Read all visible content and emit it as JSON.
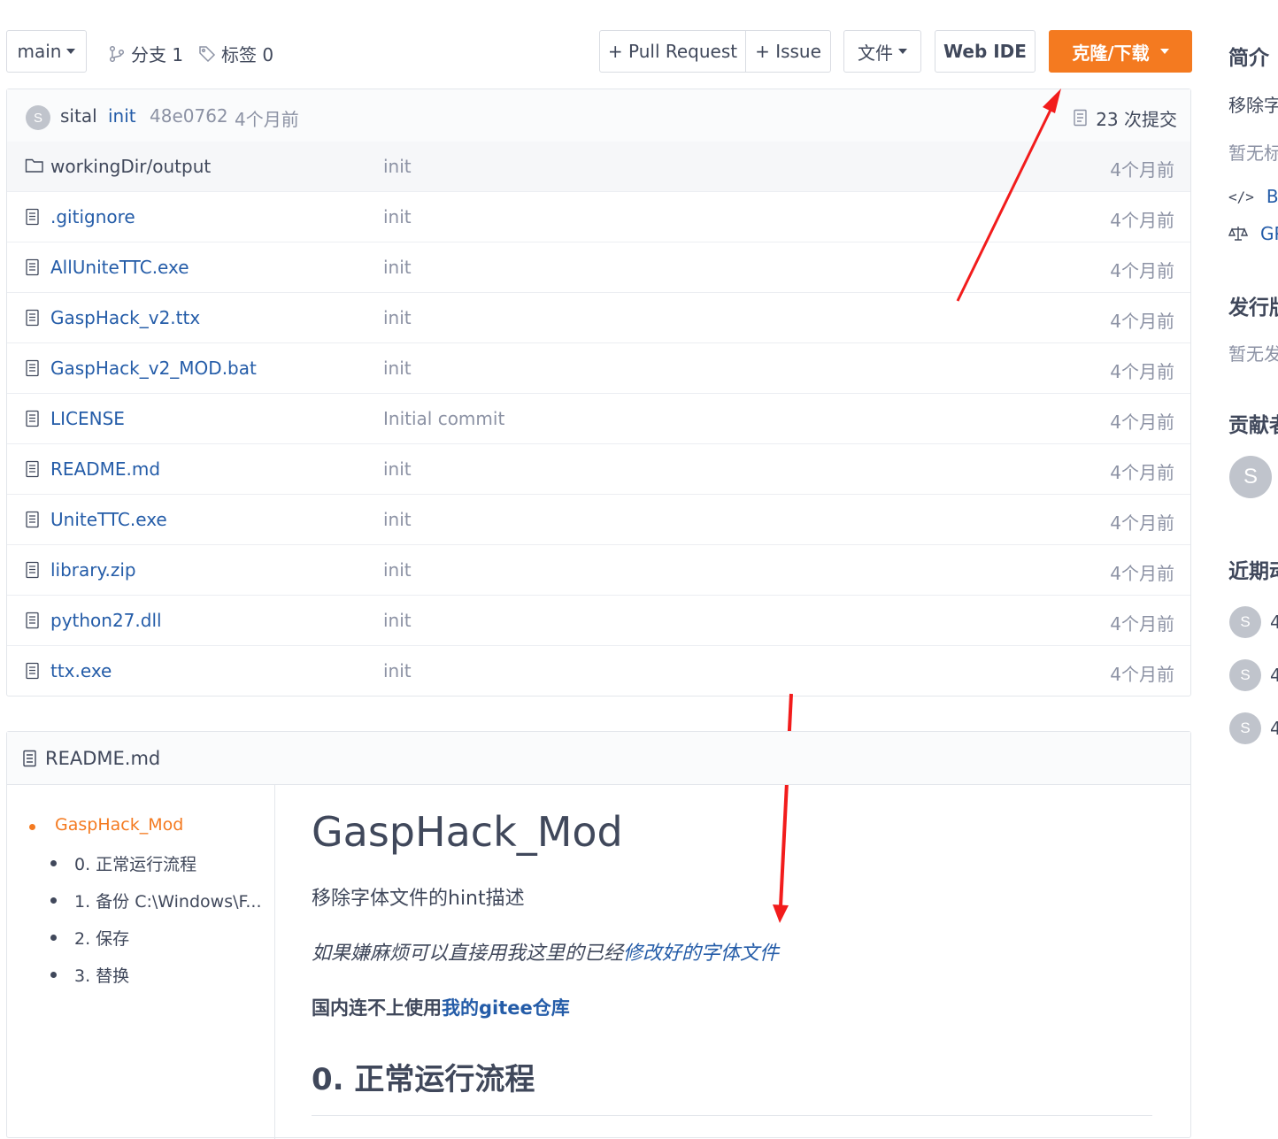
{
  "toolbar": {
    "branch": "main",
    "branches_label": "分支 1",
    "tags_label": "标签 0",
    "pull_request": "+ Pull Request",
    "issue": "+ Issue",
    "files": "文件",
    "web_ide": "Web IDE",
    "clone": "克隆/下载"
  },
  "commit": {
    "avatar_letter": "S",
    "author": "sital",
    "message": "init",
    "hash": "48e0762",
    "time": "4个月前",
    "count": "23 次提交"
  },
  "files": [
    {
      "name": "workingDir/output",
      "type": "dir",
      "message": "init",
      "time": "4个月前"
    },
    {
      "name": ".gitignore",
      "type": "file",
      "message": "init",
      "time": "4个月前"
    },
    {
      "name": "AllUniteTTC.exe",
      "type": "file",
      "message": "init",
      "time": "4个月前"
    },
    {
      "name": "GaspHack_v2.ttx",
      "type": "file",
      "message": "init",
      "time": "4个月前"
    },
    {
      "name": "GaspHack_v2_MOD.bat",
      "type": "file",
      "message": "init",
      "time": "4个月前"
    },
    {
      "name": "LICENSE",
      "type": "file",
      "message": "Initial commit",
      "time": "4个月前"
    },
    {
      "name": "README.md",
      "type": "file",
      "message": "init",
      "time": "4个月前"
    },
    {
      "name": "UniteTTC.exe",
      "type": "file",
      "message": "init",
      "time": "4个月前"
    },
    {
      "name": "library.zip",
      "type": "file",
      "message": "init",
      "time": "4个月前"
    },
    {
      "name": "python27.dll",
      "type": "file",
      "message": "init",
      "time": "4个月前"
    },
    {
      "name": "ttx.exe",
      "type": "file",
      "message": "init",
      "time": "4个月前"
    }
  ],
  "readme": {
    "filename": "README.md",
    "toc": {
      "root": "GaspHack_Mod",
      "items": [
        "0. 正常运行流程",
        "1. 备份 C:\\Windows\\F...",
        "2. 保存",
        "3. 替换"
      ]
    },
    "title": "GaspHack_Mod",
    "desc": "移除字体文件的hint描述",
    "italic_prefix": "如果嫌麻烦可以直接用我这里的已经",
    "italic_link": "修改好的字体文件",
    "bold_prefix": "国内连不上使用",
    "bold_link": "我的gitee仓库",
    "h2": "0. 正常运行流程"
  },
  "sidebar": {
    "intro_title": "简介",
    "intro_desc": "移除字",
    "no_tags": "暂无标",
    "lang": "Ba",
    "license": "GP",
    "releases_title": "发行版",
    "no_releases": "暂无发",
    "contributors_title": "贡献者",
    "contributor_letter": "S",
    "activity_title": "近期动",
    "activity_letter": "S",
    "activity_text": "4"
  },
  "colors": {
    "accent": "#f47a20",
    "link": "#245ca8",
    "arrow": "#f21c1c"
  }
}
